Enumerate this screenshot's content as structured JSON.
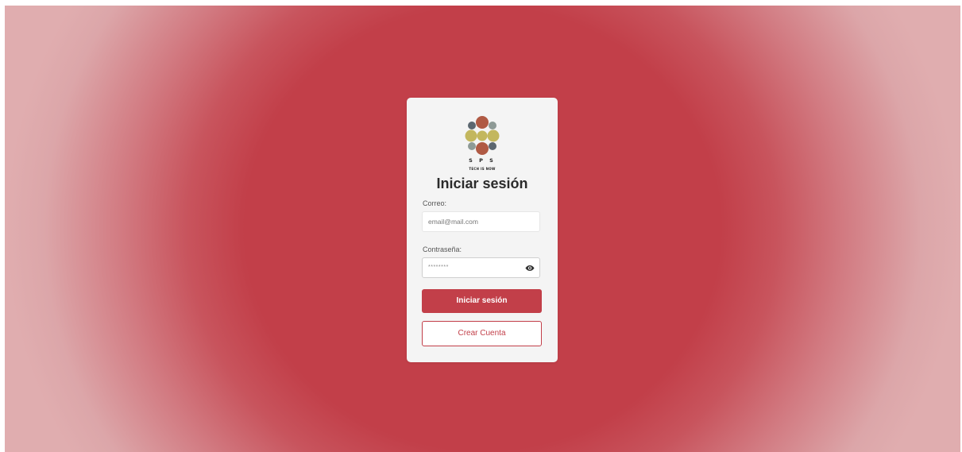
{
  "brand": {
    "logo": "sps-dots-logo",
    "name": "S P S",
    "tagline": "TECH IS NOW"
  },
  "login": {
    "title": "Iniciar sesión",
    "email_label": "Correo:",
    "email_placeholder": "email@mail.com",
    "password_label": "Contraseña:",
    "password_value": "********",
    "show_password_icon": "eye-icon",
    "submit_label": "Iniciar sesión",
    "create_account_label": "Crear Cuenta"
  },
  "colors": {
    "accent": "#c23f49",
    "card_background": "#f4f4f4",
    "logo_brown": "#b05a44",
    "logo_olive": "#c3b75e",
    "logo_slate": "#5c6770",
    "logo_grey": "#8e9a96"
  }
}
